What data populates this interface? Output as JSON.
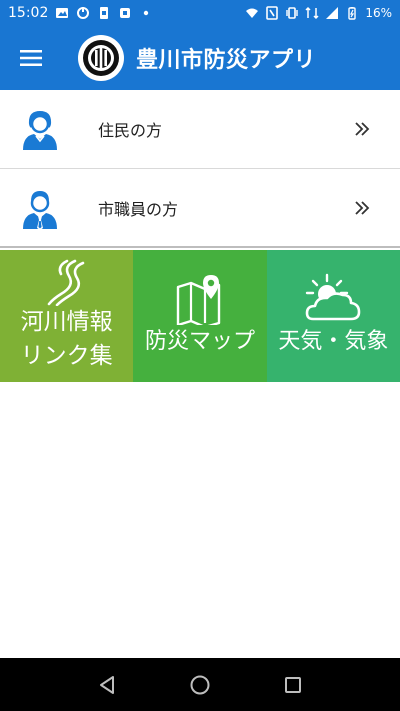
{
  "status_bar": {
    "time": "15:02",
    "battery": "16%"
  },
  "app_bar": {
    "title": "豊川市防災アプリ"
  },
  "list": [
    {
      "label": "住民の方",
      "icon": "resident-person-icon"
    },
    {
      "label": "市職員の方",
      "icon": "staff-person-icon"
    }
  ],
  "tiles": {
    "river": {
      "line1": "河川情報",
      "line2": "リンク集",
      "icon": "river-icon",
      "color": "#7fb135"
    },
    "map": {
      "label": "防災マップ",
      "icon": "map-pin-icon",
      "color": "#45b03e"
    },
    "weather": {
      "label": "天気・気象",
      "icon": "sun-cloud-icon",
      "color": "#36b36d"
    }
  },
  "colors": {
    "primary": "#1976d2",
    "person_icon": "#1a7ad4"
  }
}
